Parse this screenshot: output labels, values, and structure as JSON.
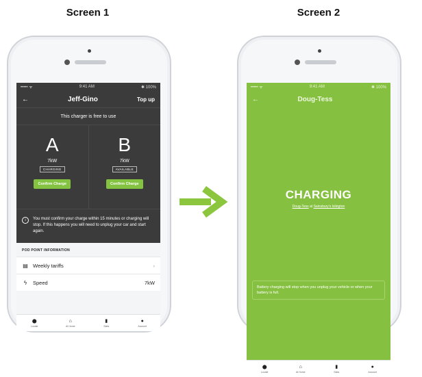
{
  "screen1": {
    "heading": "Screen 1",
    "status": {
      "signal": "••••• ᯤ",
      "time": "9:41 AM",
      "battery": "✱ 100%"
    },
    "nav": {
      "back": "←",
      "title": "Jeff-Gino",
      "action": "Top up"
    },
    "free_banner": "This charger is free to use",
    "sockets": [
      {
        "letter": "A",
        "power": "7kW",
        "status": "CHARGING",
        "button": "Confirm Charge"
      },
      {
        "letter": "B",
        "power": "7kW",
        "status": "AVAILABLE",
        "button": "Confirm Charge"
      }
    ],
    "notice": "You must confirm your charge within 15 minutes or charging will stop. If this happens you will need to unplug your car and start again.",
    "section_title": "POD POINT INFORMATION",
    "rows": [
      {
        "icon": "▤",
        "label": "Weekly tariffs",
        "value": "›"
      },
      {
        "icon": "ϟ",
        "label": "Speed",
        "value": "7kW"
      }
    ],
    "tabs": [
      {
        "icon": "⬤",
        "label": "Locate"
      },
      {
        "icon": "⌂",
        "label": "At Home"
      },
      {
        "icon": "▮",
        "label": "Stats"
      },
      {
        "icon": "●",
        "label": "Account"
      }
    ]
  },
  "screen2": {
    "heading": "Screen 2",
    "status": {
      "signal": "••••• ᯤ",
      "time": "9:41 AM",
      "battery": "✱ 100%"
    },
    "nav": {
      "back": "←",
      "title": "Doug-Tess"
    },
    "charging_title": "CHARGING",
    "charger_name": "Doug-Tess",
    "at_word": "at",
    "location": "Sainsbury's Islington",
    "info": "Battery charging will stop when you unplug your vehicle or when your battery is full.",
    "tabs": [
      {
        "icon": "⬤",
        "label": "Locate"
      },
      {
        "icon": "⌂",
        "label": "At Home"
      },
      {
        "icon": "▮",
        "label": "Stats"
      },
      {
        "icon": "●",
        "label": "Account"
      }
    ]
  },
  "colors": {
    "accent_green": "#84c341",
    "dark_panel": "#3b3b3b",
    "arrow_green": "#8cc63f"
  }
}
